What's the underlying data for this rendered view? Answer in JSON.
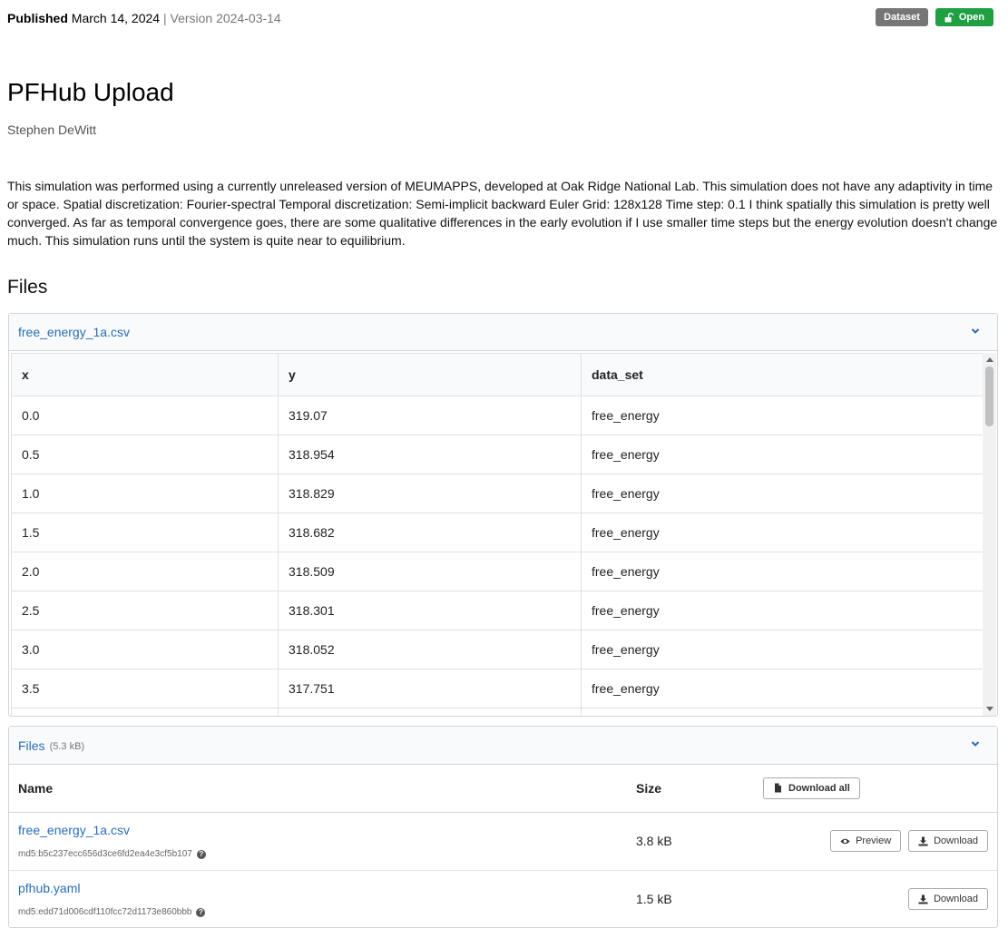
{
  "header": {
    "published_label": "Published",
    "published_date": "March 14, 2024",
    "separator": "|",
    "version_text": "Version 2024-03-14",
    "badge_dataset": "Dataset",
    "badge_open": "Open"
  },
  "record": {
    "title": "PFHub Upload",
    "author": "Stephen DeWitt",
    "description": "This simulation was performed using a currently unreleased version of MEUMAPPS, developed at Oak Ridge National Lab. This simulation does not have any adaptivity in time or space. Spatial discretization: Fourier-spectral Temporal discretization: Semi-implicit backward Euler Grid: 128x128 Time step: 0.1 I think spatially this simulation is pretty well converged. As far as temporal convergence goes, there are some qualitative differences in the early evolution if I use smaller time steps but the energy evolution doesn't change much. This simulation runs until the system is quite near to equilibrium."
  },
  "files_heading": "Files",
  "preview_panel": {
    "filename": "free_energy_1a.csv",
    "columns": [
      "x",
      "y",
      "data_set"
    ],
    "rows": [
      [
        "0.0",
        "319.07",
        "free_energy"
      ],
      [
        "0.5",
        "318.954",
        "free_energy"
      ],
      [
        "1.0",
        "318.829",
        "free_energy"
      ],
      [
        "1.5",
        "318.682",
        "free_energy"
      ],
      [
        "2.0",
        "318.509",
        "free_energy"
      ],
      [
        "2.5",
        "318.301",
        "free_energy"
      ],
      [
        "3.0",
        "318.052",
        "free_energy"
      ],
      [
        "3.5",
        "317.751",
        "free_energy"
      ]
    ]
  },
  "files_panel": {
    "title": "Files",
    "total_size": "(5.3 kB)",
    "col_name": "Name",
    "col_size": "Size",
    "download_all": "Download all",
    "files": [
      {
        "name": "free_energy_1a.csv",
        "md5": "md5:b5c237ecc656d3ce6fd2ea4e3cf5b107",
        "size": "3.8 kB",
        "preview_label": "Preview",
        "download_label": "Download"
      },
      {
        "name": "pfhub.yaml",
        "md5": "md5:edd71d006cdf110fcc72d1173e860bbb",
        "size": "1.5 kB",
        "download_label": "Download"
      }
    ]
  },
  "colors": {
    "link": "#2a6db8",
    "badge_dataset": "#767676",
    "badge_open": "#21a043"
  },
  "icons": [
    "lock-open-icon",
    "chevron-down-icon",
    "file-icon",
    "eye-icon",
    "download-icon",
    "question-circle-icon"
  ]
}
